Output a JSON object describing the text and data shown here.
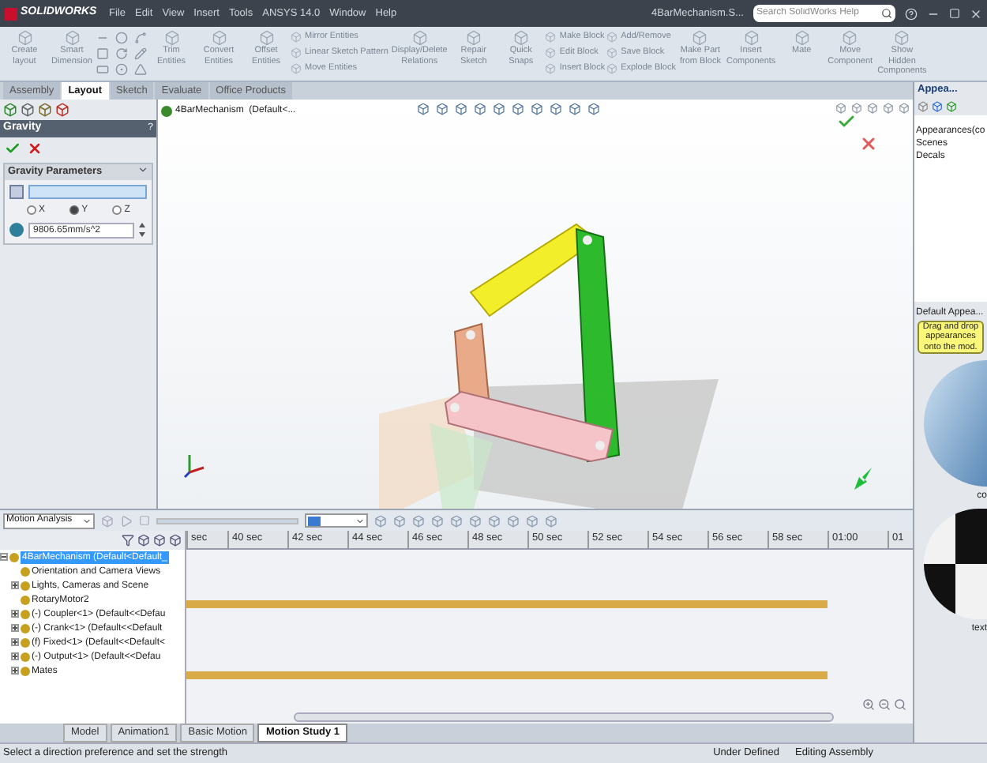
{
  "title_bar": {
    "app": "SOLIDWORKS",
    "menu": [
      "File",
      "Edit",
      "View",
      "Insert",
      "Tools",
      "ANSYS 14.0",
      "Window",
      "Help"
    ],
    "document": "4BarMechanism.S...",
    "search": {
      "placeholder": "Search SolidWorks Help"
    }
  },
  "ribbon": [
    {
      "kind": "large",
      "label": "Create layout"
    },
    {
      "kind": "large",
      "label": "Smart Dimension"
    },
    {
      "kind": "sketch"
    },
    {
      "kind": "large",
      "label": "Trim Entities"
    },
    {
      "kind": "large",
      "label": "Convert Entities"
    },
    {
      "kind": "large",
      "label": "Offset Entities"
    },
    {
      "kind": "stack",
      "items": [
        "Mirror Entities",
        "Linear Sketch Pattern",
        "Move Entities"
      ]
    },
    {
      "kind": "large",
      "label": "Display/Delete Relations"
    },
    {
      "kind": "large",
      "label": "Repair Sketch"
    },
    {
      "kind": "large",
      "label": "Quick Snaps"
    },
    {
      "kind": "stack",
      "items": [
        "Make Block",
        "Edit Block",
        "Insert Block"
      ]
    },
    {
      "kind": "stack",
      "items": [
        "Add/Remove",
        "Save Block",
        "Explode Block"
      ]
    },
    {
      "kind": "large",
      "label": "Make Part from Block"
    },
    {
      "kind": "large",
      "label": "Insert Components"
    },
    {
      "kind": "large",
      "label": "Mate"
    },
    {
      "kind": "large",
      "label": "Move Component"
    },
    {
      "kind": "large",
      "label": "Show Hidden Components"
    }
  ],
  "tabs": [
    {
      "label": "Assembly",
      "selected": false
    },
    {
      "label": "Layout",
      "selected": true
    },
    {
      "label": "Sketch",
      "selected": false
    },
    {
      "label": "Evaluate",
      "selected": false
    },
    {
      "label": "Office Products",
      "selected": false
    }
  ],
  "property_manager": {
    "title": "Gravity",
    "help": "?",
    "section": "Gravity Parameters",
    "axes": [
      {
        "label": "X",
        "selected": false
      },
      {
        "label": "Y",
        "selected": true
      },
      {
        "label": "Z",
        "selected": false
      }
    ],
    "acceleration": "9806.65mm/s^2"
  },
  "tree_flyout": "4BarMechanism  (Default<...",
  "task_pane": {
    "title": "Appea...",
    "items": [
      "Appearances(co",
      "Scenes",
      "Decals"
    ],
    "section": "Default Appea...",
    "tooltip": "Drag and drop appearances onto the mod.",
    "swatches": [
      {
        "label": "co"
      },
      {
        "label": "text"
      }
    ]
  },
  "motion": {
    "study_type": "Motion Analysis",
    "playback": {
      "level": 1
    },
    "tree": {
      "label": "4BarMechanism  (Default<Default_",
      "selected": true,
      "expanded": true,
      "timeline_bar": false,
      "children": [
        {
          "label": "Orientation and Camera Views",
          "expandable": false,
          "timeline_bar": false
        },
        {
          "label": "Lights, Cameras and Scene",
          "expandable": true,
          "timeline_bar": false
        },
        {
          "label": "RotaryMotor2",
          "expandable": false,
          "timeline_bar": true
        },
        {
          "label": "(-) Coupler<1> (Default<<Defau",
          "expandable": true,
          "timeline_bar": false
        },
        {
          "label": "(-) Crank<1> (Default<<Default",
          "expandable": true,
          "timeline_bar": false
        },
        {
          "label": "(f) Fixed<1> (Default<<Default<",
          "expandable": true,
          "timeline_bar": false
        },
        {
          "label": "(-) Output<1> (Default<<Defau",
          "expandable": true,
          "timeline_bar": false
        },
        {
          "label": "Mates",
          "expandable": true,
          "timeline_bar": true
        }
      ]
    },
    "ruler": [
      "sec",
      "40 sec",
      "42 sec",
      "44 sec",
      "46 sec",
      "48 sec",
      "50 sec",
      "52 sec",
      "54 sec",
      "56 sec",
      "58 sec",
      "01:00",
      "01"
    ]
  },
  "bottom_tabs": [
    {
      "label": "Model",
      "selected": false
    },
    {
      "label": "Animation1",
      "selected": false
    },
    {
      "label": "Basic Motion",
      "selected": false
    },
    {
      "label": "Motion Study 1",
      "selected": true
    }
  ],
  "status_bar": {
    "message": "Select a direction preference and set the strength",
    "fields": [
      "Under Defined",
      "Editing Assembly"
    ]
  }
}
